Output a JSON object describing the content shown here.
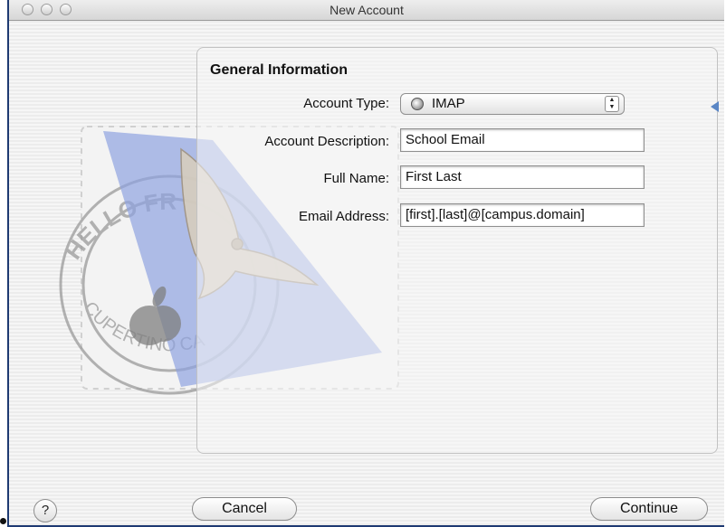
{
  "window": {
    "title": "New Account"
  },
  "section": {
    "title": "General Information"
  },
  "form": {
    "account_type_label": "Account Type:",
    "account_type_value": "IMAP",
    "account_description_label": "Account Description:",
    "account_description_value": "School Email",
    "full_name_label": "Full Name:",
    "full_name_value": "First Last",
    "email_label": "Email Address:",
    "email_value": "[first].[last]@[campus.domain]"
  },
  "buttons": {
    "help": "?",
    "cancel": "Cancel",
    "continue": "Continue"
  },
  "stamp": {
    "text_top": "HELLO FR",
    "text_bottom": "CUPERTINO CA"
  },
  "icons": {
    "account_type": "globe-icon",
    "stepper": "stepper-arrows-icon",
    "hint": "left-arrow-icon"
  },
  "colors": {
    "frame_border": "#1e3a72",
    "stamp_blue": "#8ea3e0",
    "hint_arrow": "#5a86c5"
  }
}
